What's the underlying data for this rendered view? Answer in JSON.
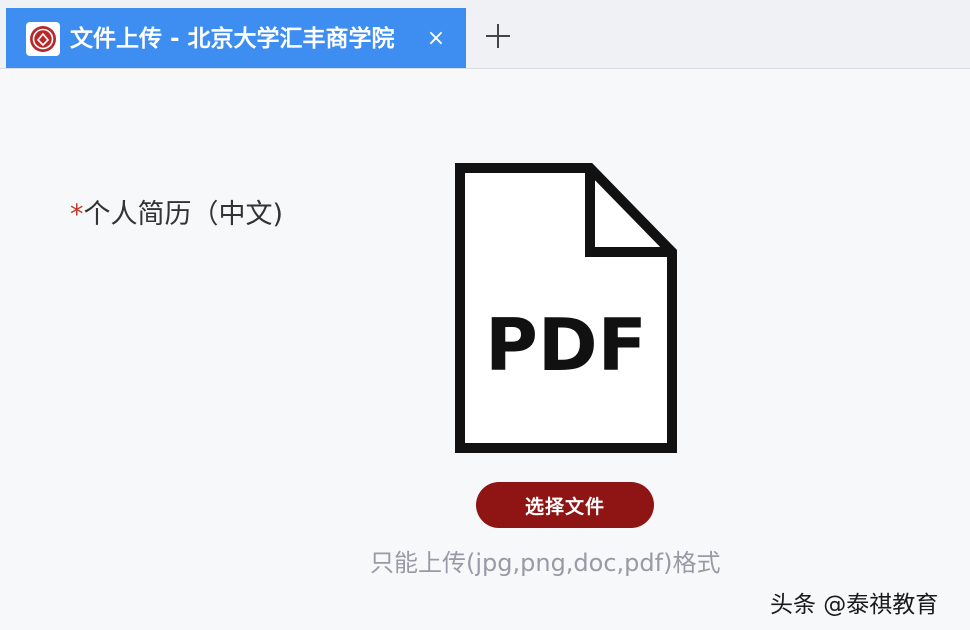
{
  "tab": {
    "title": "文件上传 - 北京大学汇丰商学院",
    "close_glyph": "×",
    "favicon_icon": "university-seal-icon",
    "active_color": "#3d8ef0"
  },
  "new_tab_icon": "plus-icon",
  "upload": {
    "required_mark": "*",
    "label": "个人简历（中文)",
    "file_icon": "pdf-file-icon",
    "file_icon_text": "PDF",
    "button_label": "选择文件",
    "button_color": "#8f1414",
    "hint": "只能上传(jpg,png,doc,pdf)格式"
  },
  "watermark": "头条 @泰祺教育"
}
